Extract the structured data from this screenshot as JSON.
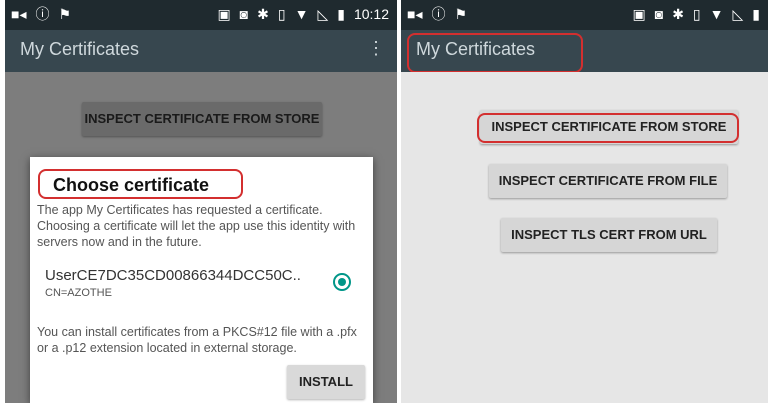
{
  "status_bar": {
    "left_icons": [
      "video-camera-icon",
      "info-icon",
      "flag-icon"
    ],
    "right_icons": [
      "briefcase-icon",
      "cast-icon",
      "bluetooth-icon",
      "vibrate-icon",
      "wifi-icon",
      "no-signal-icon",
      "battery-icon"
    ],
    "time": "10:12"
  },
  "left_screen": {
    "app_title": "My Certificates",
    "buttons": [
      "INSPECT CERTIFICATE FROM STORE"
    ],
    "dialog": {
      "title": "Choose certificate",
      "message": "The app My Certificates has requested a certificate. Choosing a certificate will let the app use this identity with servers now and in the future.",
      "certificate_name": "UserCE7DC35CD00866344DCC50C..",
      "certificate_subtitle": "CN=AZOTHE",
      "install_message": "You can install certificates from a PKCS#12 file with a .pfx or a .p12 extension located in external storage.",
      "install_button": "INSTALL"
    }
  },
  "right_screen": {
    "app_title": "My Certificates",
    "buttons": [
      "INSPECT CERTIFICATE FROM STORE",
      "INSPECT CERTIFICATE FROM FILE",
      "INSPECT TLS CERT FROM URL"
    ]
  },
  "colors": {
    "highlight": "#d32f2f",
    "radio_accent": "#009688",
    "app_bar": "#37474f"
  }
}
